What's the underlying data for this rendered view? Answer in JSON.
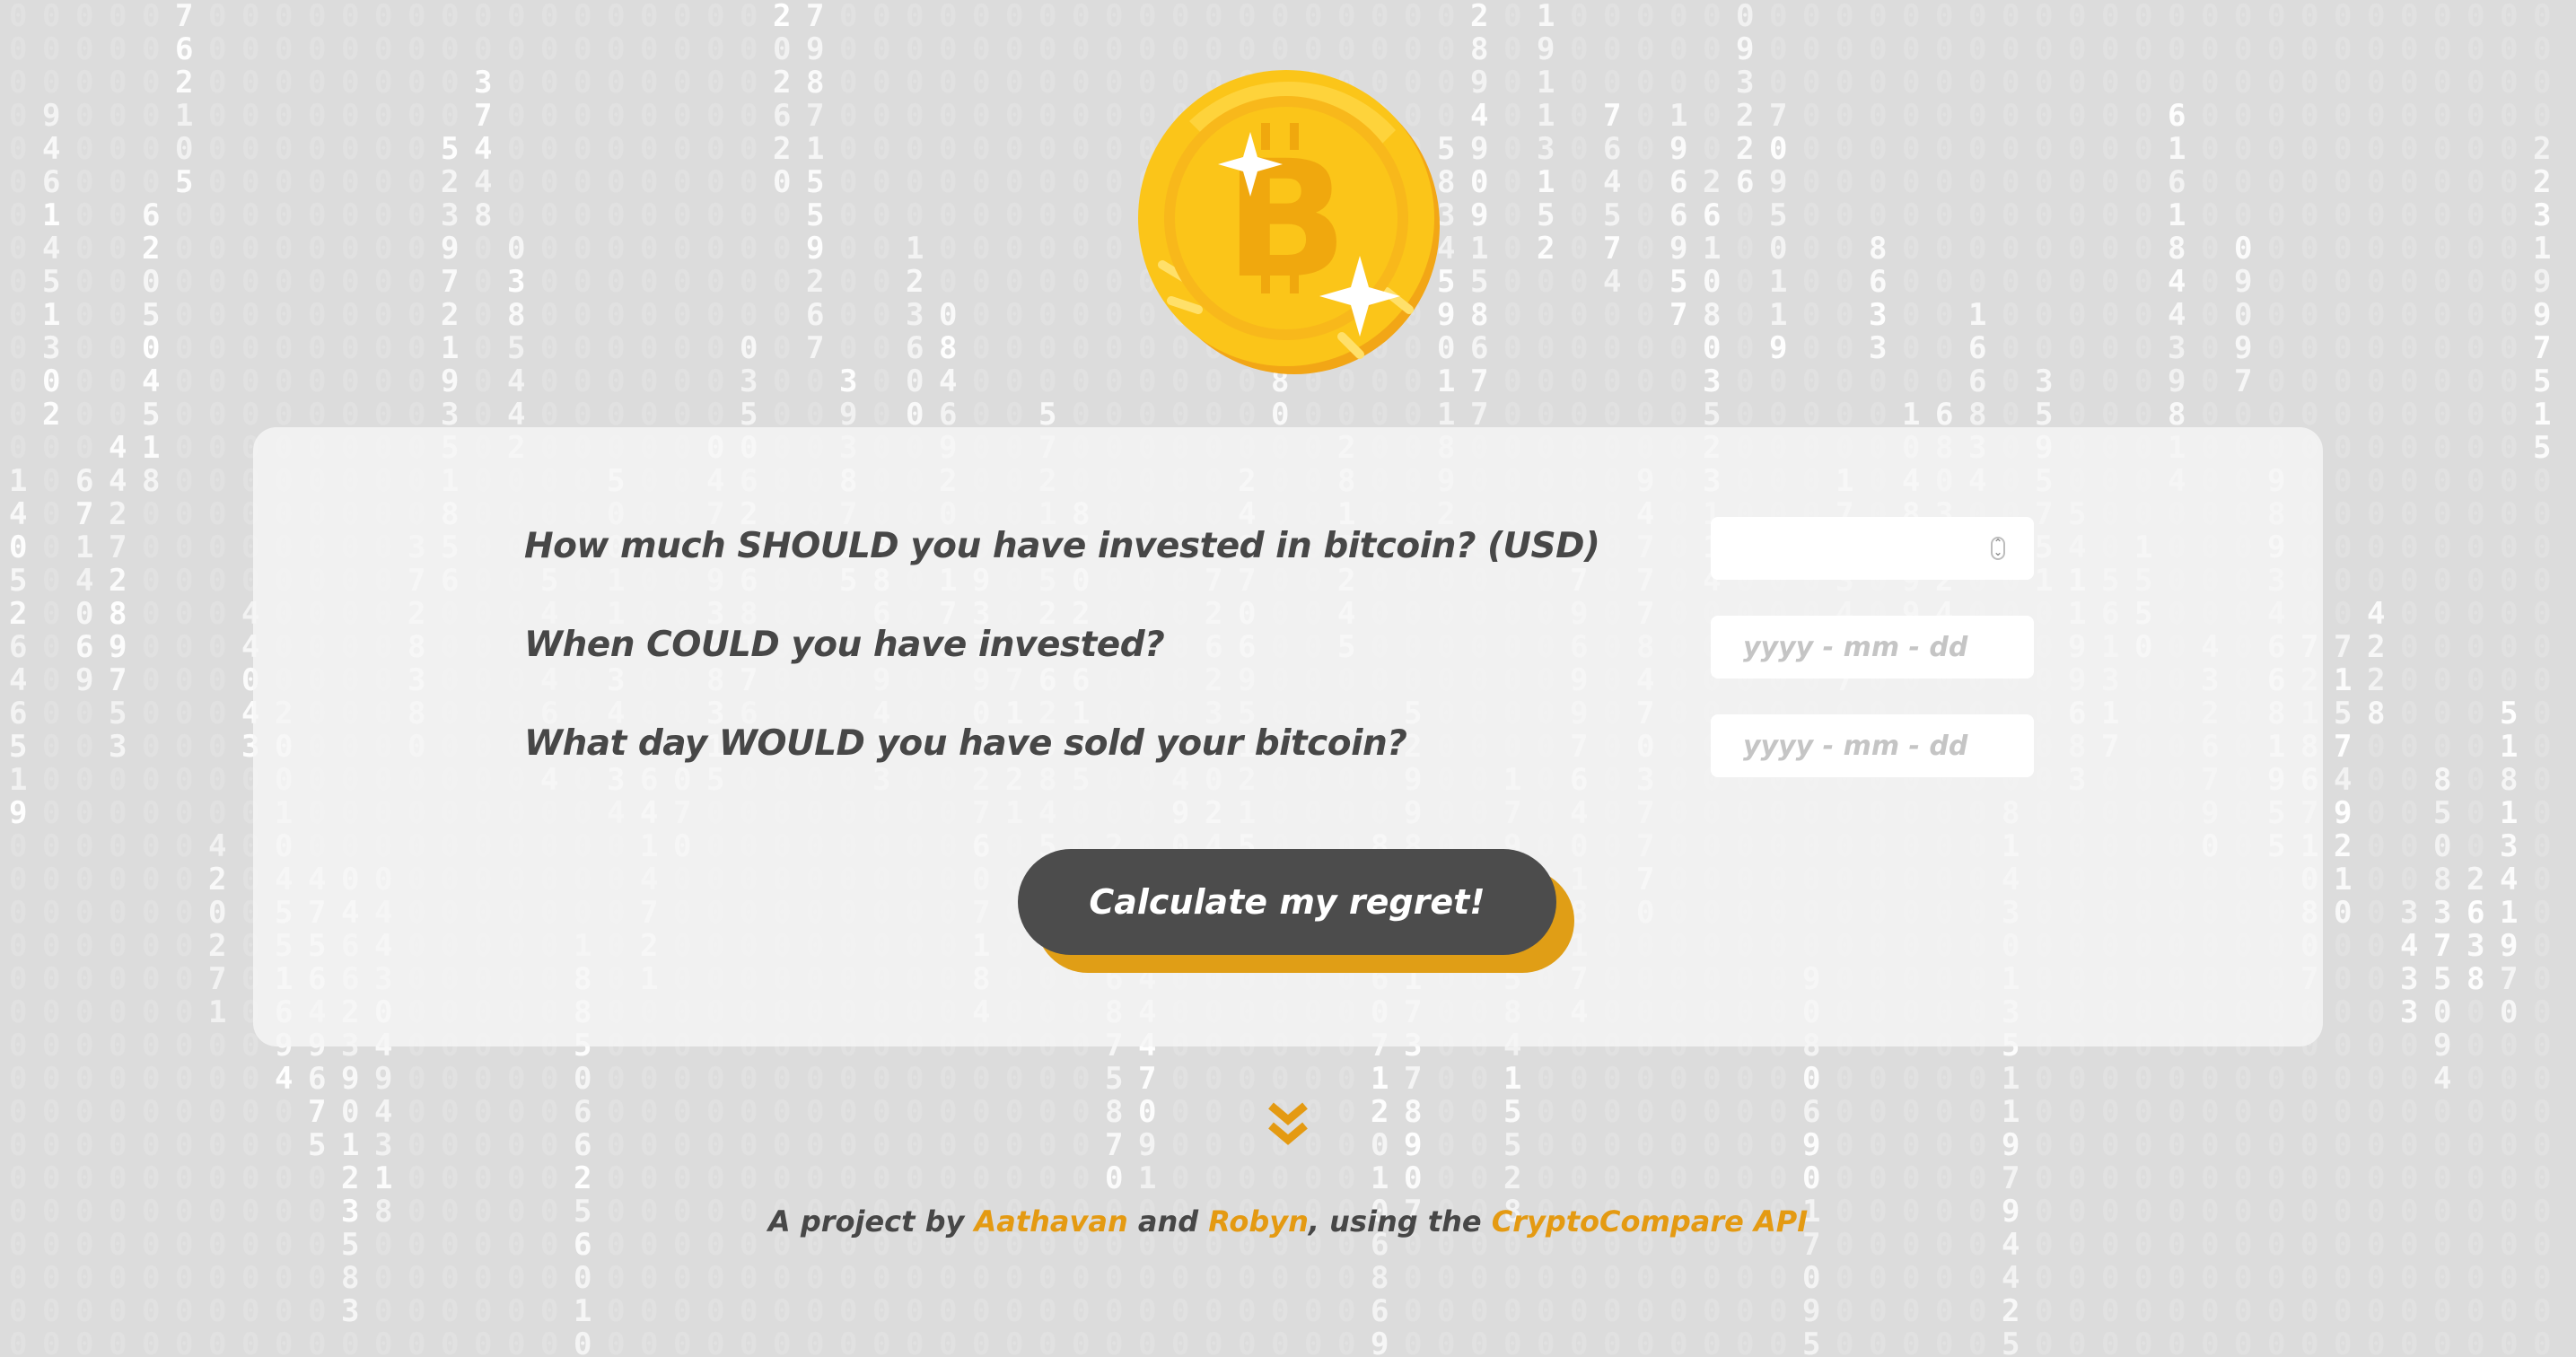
{
  "form": {
    "amount_label": "How much SHOULD you have invested in bitcoin? (USD)",
    "amount_value": "",
    "buy_date_label": "When COULD you have invested?",
    "buy_date_placeholder": "yyyy - mm - dd",
    "sell_date_label": "What day WOULD you have sold your bitcoin?",
    "sell_date_placeholder": "yyyy - mm - dd"
  },
  "button": {
    "label": "Calculate my regret!"
  },
  "footer": {
    "prefix": "A project by ",
    "author1": "Aathavan",
    "middle": " and ",
    "author2": "Robyn",
    "middle2": ", using the ",
    "api_link": "CryptoCompare API"
  },
  "icons": {
    "coin": "bitcoin-coin-icon",
    "scroll": "double-chevron-down-icon",
    "spinner": "number-spinner-icon"
  },
  "colors": {
    "background": "#dcdcdc",
    "card": "#f5f5f5",
    "button": "#4c4c4c",
    "button_shadow": "#e09e16",
    "accent": "#e49a12",
    "text": "#474747",
    "coin": "#fbc519"
  }
}
